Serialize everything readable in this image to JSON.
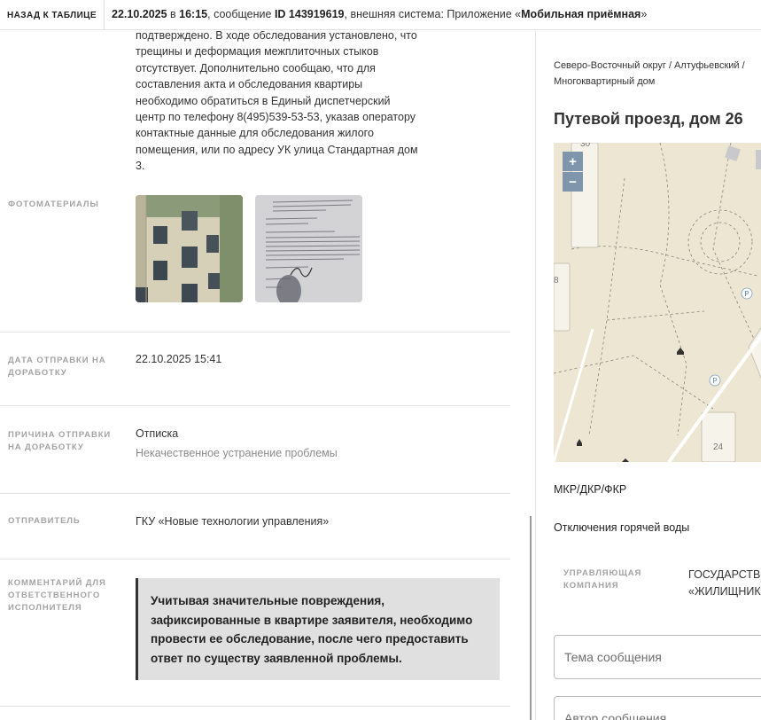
{
  "topbar": {
    "back_label": "НАЗАД К ТАБЛИЦЕ",
    "date": "22.10.2025",
    "at": " в ",
    "time": "16:15",
    "msg_prefix": ", сообщение ",
    "msg_id": "ID 143919619",
    "system_prefix": ", внешняя система: Приложение «",
    "system_name": "Мобильная приёмная",
    "system_suffix": "»"
  },
  "answer_text": "подтверждено. В ходе обследования установлено, что трещины и деформация межплиточных стыков отсутствует. Дополнительно сообщаю, что для составления акта и обследования квартиры необходимо обратиться в Единый диспетчерский центр по телефону 8(495)539-53-53, указав оператору контактные данные для обследования жилого помещения, или по адресу УК улица Стандартная дом 3.",
  "photos": {
    "label": "ФОТОМАТЕРИАЛЫ"
  },
  "sent_date": {
    "label": "ДАТА ОТПРАВКИ НА ДОРАБОТКУ",
    "value": "22.10.2025 15:41"
  },
  "reason": {
    "label": "ПРИЧИНА ОТПРАВКИ НА ДОРАБОТКУ",
    "value": "Отписка",
    "detail": "Некачественное устранение проблемы"
  },
  "sender": {
    "label": "ОТПРАВИТЕЛЬ",
    "value": "ГКУ «Новые технологии управления»"
  },
  "comment": {
    "label": "КОММЕНТАРИЙ ДЛЯ ОТВЕТСТВЕННОГО ИСПОЛНИТЕЛЯ",
    "text": "Учитывая значительные повреждения, зафиксированные в квартире заявителя, необходимо провести ее обследование, после чего предоставить ответ по существу заявленной проблемы."
  },
  "right": {
    "address_line1": "Северо-Восточный округ / Алтуфьевский /",
    "address_line2": "Многоквартирный дом",
    "house_title": "Путевой проезд, дом 26",
    "map": {
      "zoom_in": "+",
      "zoom_out": "−",
      "label_30": "30",
      "label_8": "8",
      "label_24": "24",
      "parking": "P"
    },
    "mkr": "МКР/ДКР/ФКР",
    "hot_water": "Отключения горячей воды",
    "uk_label_line1": "УПРАВЛЯЮЩАЯ",
    "uk_label_line2": "КОМПАНИЯ",
    "uk_value_line1": "ГОСУДАРСТВЕ",
    "uk_value_line2": "«ЖИЛИЩНИК",
    "subject_placeholder": "Тема сообщения",
    "author_placeholder": "Автор сообщения"
  },
  "colors": {
    "comment_bg": "#e0e0e0",
    "map_bg": "#ece6d3",
    "zoom_btn": "#7f95ac"
  }
}
